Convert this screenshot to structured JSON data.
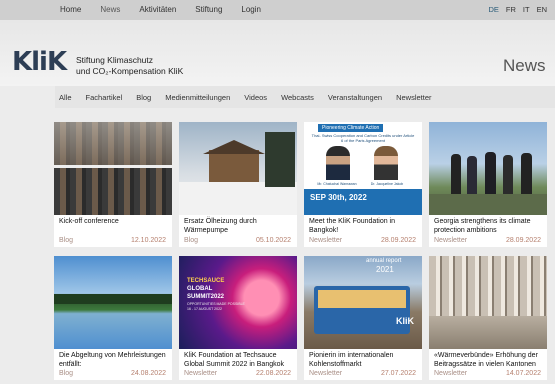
{
  "nav": {
    "items": [
      "Home",
      "News",
      "Aktivitäten",
      "Stiftung",
      "Login"
    ],
    "active": "News",
    "languages": [
      "DE",
      "FR",
      "IT",
      "EN"
    ],
    "active_language": "DE"
  },
  "brand": {
    "logo_text": "KliK",
    "subtitle_line1": "Stiftung Klimaschutz",
    "subtitle_line2": "und CO₂-Kompensation KliK"
  },
  "page": {
    "title": "News"
  },
  "filters": [
    "Alle",
    "Fachartikel",
    "Blog",
    "Medienmitteilungen",
    "Videos",
    "Webcasts",
    "Veranstaltungen",
    "Newsletter"
  ],
  "cards": [
    {
      "title": "Kick-off conference",
      "category": "Blog",
      "date": "12.10.2022"
    },
    {
      "title": "Ersatz Ölheizung durch Wärmepumpe",
      "category": "Blog",
      "date": "05.10.2022"
    },
    {
      "title": "Meet the KliK Foundation in Bangkok!",
      "category": "Newsletter",
      "date": "28.09.2022",
      "image_text": {
        "banner": "Pioneering Climate Action",
        "heading": "Thai- Swiss Cooperation and Carbon Credits under Article 6 of the Paris Agreement",
        "person1": "Mr. Chatuchai Wanrawan",
        "person2": "Dr. Jacqueline Jakob",
        "date": "SEP 30th, 2022"
      }
    },
    {
      "title": "Georgia strengthens its climate protection ambitions",
      "category": "Newsletter",
      "date": "28.09.2022"
    },
    {
      "title": "Die Abgeltung von Mehrleistungen entfällt:",
      "category": "Blog",
      "date": "24.08.2022"
    },
    {
      "title": "KliK Foundation at Techsauce Global Summit 2022 in Bangkok",
      "category": "Newsletter",
      "date": "22.08.2022",
      "image_text": {
        "line1": "TECHSAUCE",
        "line2": "GLOBAL",
        "line3": "SUMMIT2022",
        "line4": "OPPORTUNITIES MADE POSSIBLE",
        "line5": "16 - 17 AUGUST 2022"
      }
    },
    {
      "title": "Pionierin im internationalen Kohlenstoffmarkt",
      "category": "Newsletter",
      "date": "27.07.2022",
      "image_text": {
        "label": "annual report",
        "year": "2021",
        "logo": "KliK"
      }
    },
    {
      "title": "«Wärmeverbünde» Erhöhung der Beitragssätze in vielen Kantonen",
      "category": "Newsletter",
      "date": "14.07.2022"
    }
  ]
}
